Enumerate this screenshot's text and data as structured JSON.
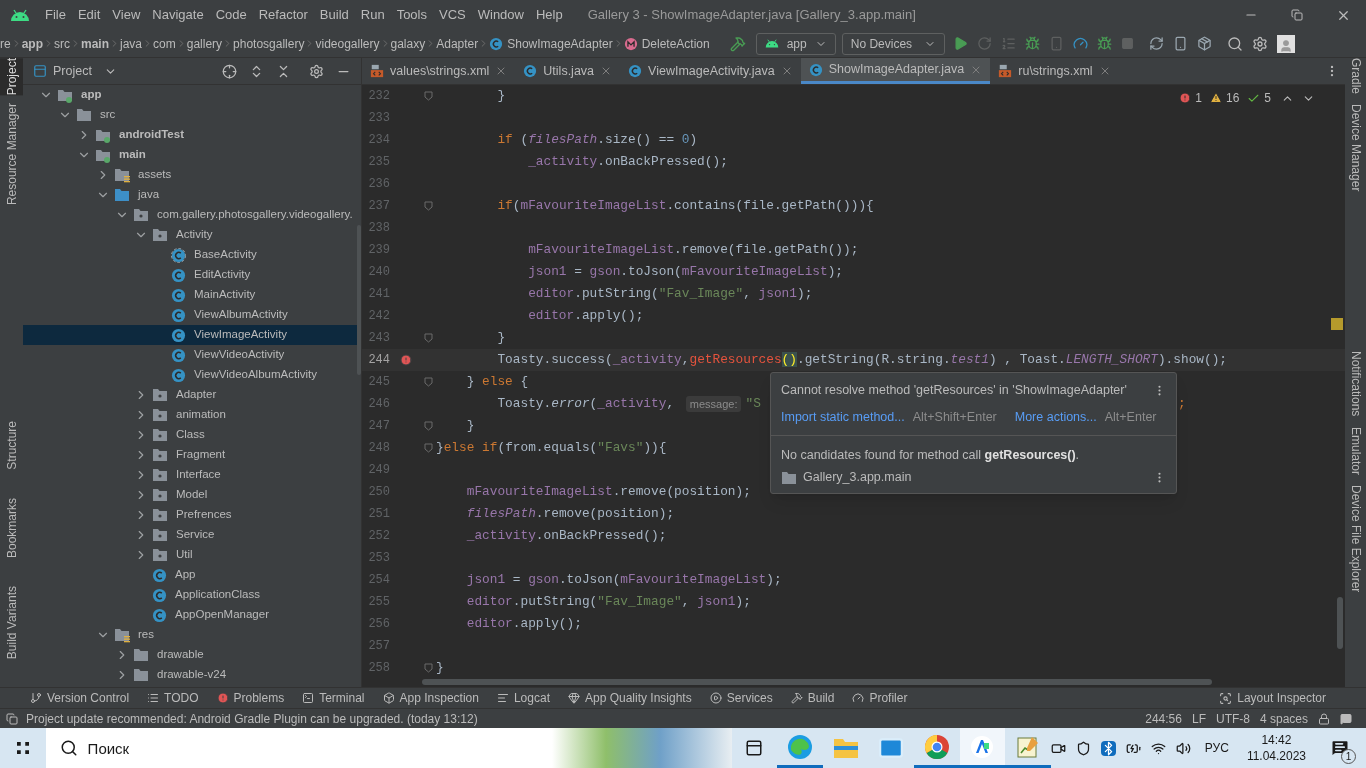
{
  "window": {
    "title": "Gallery 3 - ShowImageAdapter.java [Gallery_3.app.main]",
    "menu": [
      "File",
      "Edit",
      "View",
      "Navigate",
      "Code",
      "Refactor",
      "Build",
      "Run",
      "Tools",
      "VCS",
      "Window",
      "Help"
    ]
  },
  "navbar": {
    "breadcrumbs": [
      {
        "label": "re",
        "kind": "text"
      },
      {
        "label": "app",
        "kind": "bold"
      },
      {
        "label": "src",
        "kind": "text"
      },
      {
        "label": "main",
        "kind": "bold"
      },
      {
        "label": "java",
        "kind": "text"
      },
      {
        "label": "com",
        "kind": "text"
      },
      {
        "label": "gallery",
        "kind": "text"
      },
      {
        "label": "photosgallery",
        "kind": "text"
      },
      {
        "label": "videogallery",
        "kind": "text"
      },
      {
        "label": "galaxy",
        "kind": "text"
      },
      {
        "label": "Adapter",
        "kind": "text"
      },
      {
        "label": "ShowImageAdapter",
        "kind": "class"
      },
      {
        "label": "DeleteAction",
        "kind": "method"
      }
    ],
    "run_config": "app",
    "device": "No Devices"
  },
  "left_strip": [
    {
      "label": "Project",
      "selected": true
    },
    {
      "label": "Resource Manager",
      "selected": false
    },
    {
      "label": "Structure",
      "selected": false
    },
    {
      "label": "Bookmarks",
      "selected": false
    },
    {
      "label": "Build Variants",
      "selected": false
    }
  ],
  "right_strip": [
    "Gradle",
    "Device Manager",
    "Notifications",
    "Emulator",
    "Device File Explorer"
  ],
  "project_panel": {
    "title": "Project",
    "tree": [
      {
        "label": "app",
        "kind": "module",
        "expanded": true,
        "selected": false,
        "children": [
          {
            "label": "src",
            "kind": "folder",
            "expanded": true,
            "selected": false,
            "children": [
              {
                "label": "androidTest",
                "kind": "module",
                "expanded": false,
                "selected": false
              },
              {
                "label": "main",
                "kind": "module",
                "expanded": true,
                "selected": false,
                "children": [
                  {
                    "label": "assets",
                    "kind": "res-folder",
                    "expanded": false,
                    "selected": false
                  },
                  {
                    "label": "java",
                    "kind": "source-folder",
                    "expanded": true,
                    "selected": false,
                    "children": [
                      {
                        "label": "com.gallery.photosgallery.videogallery.",
                        "kind": "package",
                        "expanded": true,
                        "selected": false,
                        "children": [
                          {
                            "label": "Activity",
                            "kind": "package",
                            "expanded": true,
                            "selected": false,
                            "children": [
                              {
                                "label": "BaseActivity",
                                "kind": "abstract-class",
                                "selected": false
                              },
                              {
                                "label": "EditActivity",
                                "kind": "class",
                                "selected": false
                              },
                              {
                                "label": "MainActivity",
                                "kind": "class",
                                "selected": false
                              },
                              {
                                "label": "ViewAlbumActivity",
                                "kind": "class",
                                "selected": false
                              },
                              {
                                "label": "ViewImageActivity",
                                "kind": "class",
                                "selected": true
                              },
                              {
                                "label": "ViewVideoActivity",
                                "kind": "class",
                                "selected": false
                              },
                              {
                                "label": "ViewVideoAlbumActivity",
                                "kind": "class",
                                "selected": false
                              }
                            ]
                          },
                          {
                            "label": "Adapter",
                            "kind": "package",
                            "expanded": false,
                            "selected": false
                          },
                          {
                            "label": "animation",
                            "kind": "package",
                            "expanded": false,
                            "selected": false
                          },
                          {
                            "label": "Class",
                            "kind": "package",
                            "expanded": false,
                            "selected": false
                          },
                          {
                            "label": "Fragment",
                            "kind": "package",
                            "expanded": false,
                            "selected": false
                          },
                          {
                            "label": "Interface",
                            "kind": "package",
                            "expanded": false,
                            "selected": false
                          },
                          {
                            "label": "Model",
                            "kind": "package",
                            "expanded": false,
                            "selected": false
                          },
                          {
                            "label": "Prefrences",
                            "kind": "package",
                            "expanded": false,
                            "selected": false
                          },
                          {
                            "label": "Service",
                            "kind": "package",
                            "expanded": false,
                            "selected": false
                          },
                          {
                            "label": "Util",
                            "kind": "package",
                            "expanded": false,
                            "selected": false
                          },
                          {
                            "label": "App",
                            "kind": "class",
                            "selected": false
                          },
                          {
                            "label": "ApplicationClass",
                            "kind": "class",
                            "selected": false
                          },
                          {
                            "label": "AppOpenManager",
                            "kind": "class",
                            "selected": false
                          }
                        ]
                      }
                    ]
                  },
                  {
                    "label": "res",
                    "kind": "res-folder",
                    "expanded": true,
                    "selected": false,
                    "children": [
                      {
                        "label": "drawable",
                        "kind": "folder",
                        "expanded": false,
                        "selected": false
                      },
                      {
                        "label": "drawable-v24",
                        "kind": "folder",
                        "expanded": false,
                        "selected": false
                      }
                    ]
                  }
                ]
              }
            ]
          }
        ]
      }
    ]
  },
  "editor": {
    "tabs": [
      {
        "label": "values\\strings.xml",
        "kind": "xml",
        "selected": false
      },
      {
        "label": "Utils.java",
        "kind": "class",
        "selected": false
      },
      {
        "label": "ViewImageActivity.java",
        "kind": "class",
        "selected": false
      },
      {
        "label": "ShowImageAdapter.java",
        "kind": "class",
        "selected": true
      },
      {
        "label": "ru\\strings.xml",
        "kind": "xml",
        "selected": false
      }
    ],
    "indicators": {
      "errors": "1",
      "warnings": "16",
      "weak_warnings": "5"
    },
    "lines": [
      {
        "number": "232",
        "current": false,
        "error": false,
        "fold": true,
        "tokens": [
          {
            "kind": "plain",
            "text": "        }"
          }
        ]
      },
      {
        "number": "233",
        "current": false,
        "error": false,
        "fold": false
      },
      {
        "number": "234",
        "current": false,
        "error": false,
        "fold": false,
        "tokens": [
          {
            "kind": "keyword",
            "text": "        if"
          },
          {
            "kind": "plain",
            "text": " ("
          },
          {
            "kind": "static_field",
            "text": "filesPath"
          },
          {
            "kind": "plain",
            "text": ".size() == "
          },
          {
            "kind": "number",
            "text": "0"
          },
          {
            "kind": "plain",
            "text": ")"
          }
        ]
      },
      {
        "number": "235",
        "current": false,
        "error": false,
        "fold": false,
        "tokens": [
          {
            "kind": "field",
            "text": "            _activity"
          },
          {
            "kind": "plain",
            "text": ".onBackPressed();"
          }
        ]
      },
      {
        "number": "236",
        "current": false,
        "error": false,
        "fold": false
      },
      {
        "number": "237",
        "current": false,
        "error": false,
        "fold": true,
        "tokens": [
          {
            "kind": "keyword",
            "text": "        if"
          },
          {
            "kind": "plain",
            "text": "("
          },
          {
            "kind": "field",
            "text": "mFavouriteImageList"
          },
          {
            "kind": "plain",
            "text": ".contains(file.getPath())){"
          }
        ]
      },
      {
        "number": "238",
        "current": false,
        "error": false,
        "fold": false
      },
      {
        "number": "239",
        "current": false,
        "error": false,
        "fold": false,
        "tokens": [
          {
            "kind": "field",
            "text": "            mFavouriteImageList"
          },
          {
            "kind": "plain",
            "text": ".remove(file.getPath());"
          }
        ]
      },
      {
        "number": "240",
        "current": false,
        "error": false,
        "fold": false,
        "tokens": [
          {
            "kind": "field",
            "text": "            json1"
          },
          {
            "kind": "plain",
            "text": " = "
          },
          {
            "kind": "field",
            "text": "gson"
          },
          {
            "kind": "plain",
            "text": ".toJson("
          },
          {
            "kind": "field",
            "text": "mFavouriteImageList"
          },
          {
            "kind": "plain",
            "text": ");"
          }
        ]
      },
      {
        "number": "241",
        "current": false,
        "error": false,
        "fold": false,
        "tokens": [
          {
            "kind": "field",
            "text": "            editor"
          },
          {
            "kind": "plain",
            "text": ".putString("
          },
          {
            "kind": "string",
            "text": "\"Fav_Image\""
          },
          {
            "kind": "plain",
            "text": ", "
          },
          {
            "kind": "field",
            "text": "json1"
          },
          {
            "kind": "plain",
            "text": ");"
          }
        ]
      },
      {
        "number": "242",
        "current": false,
        "error": false,
        "fold": false,
        "tokens": [
          {
            "kind": "field",
            "text": "            editor"
          },
          {
            "kind": "plain",
            "text": ".apply();"
          }
        ]
      },
      {
        "number": "243",
        "current": false,
        "error": false,
        "fold": true,
        "tokens": [
          {
            "kind": "plain",
            "text": "        }"
          }
        ]
      },
      {
        "number": "244",
        "current": true,
        "error": true,
        "fold": false,
        "tokens": [
          {
            "kind": "plain",
            "text": "        Toasty.success("
          },
          {
            "kind": "field",
            "text": "_activity"
          },
          {
            "kind": "plain",
            "text": ","
          },
          {
            "kind": "error",
            "text": "getResources"
          },
          {
            "kind": "matched_brace",
            "text": "()"
          },
          {
            "kind": "plain",
            "text": ".getString(R.string."
          },
          {
            "kind": "static_field",
            "text": "test1"
          },
          {
            "kind": "plain",
            "text": ") , Toast."
          },
          {
            "kind": "static_field",
            "text": "LENGTH_SHORT"
          },
          {
            "kind": "plain",
            "text": ").show();"
          }
        ]
      },
      {
        "number": "245",
        "current": false,
        "error": false,
        "fold": true,
        "tokens": [
          {
            "kind": "plain",
            "text": "    } "
          },
          {
            "kind": "keyword",
            "text": "else"
          },
          {
            "kind": "plain",
            "text": " {"
          }
        ]
      },
      {
        "number": "246",
        "current": false,
        "error": false,
        "fold": false,
        "tokens": [
          {
            "kind": "plain",
            "text": "        Toasty."
          },
          {
            "kind": "static_method",
            "text": "error"
          },
          {
            "kind": "plain",
            "text": "("
          },
          {
            "kind": "field",
            "text": "_activity"
          },
          {
            "kind": "plain",
            "text": ", "
          },
          {
            "kind": "hint",
            "text": "message:"
          },
          {
            "kind": "string",
            "text": "\"S"
          }
        ],
        "tail": ";"
      },
      {
        "number": "247",
        "current": false,
        "error": false,
        "fold": true,
        "tokens": [
          {
            "kind": "plain",
            "text": "    }"
          }
        ]
      },
      {
        "number": "248",
        "current": false,
        "error": false,
        "fold": true,
        "tokens": [
          {
            "kind": "plain",
            "text": "}"
          },
          {
            "kind": "keyword",
            "text": "else if"
          },
          {
            "kind": "plain",
            "text": "(from.equals("
          },
          {
            "kind": "string",
            "text": "\"Favs\""
          },
          {
            "kind": "plain",
            "text": ")){"
          }
        ]
      },
      {
        "number": "249",
        "current": false,
        "error": false,
        "fold": false
      },
      {
        "number": "250",
        "current": false,
        "error": false,
        "fold": false,
        "tokens": [
          {
            "kind": "field",
            "text": "    mFavouriteImageList"
          },
          {
            "kind": "plain",
            "text": ".remove(position);"
          }
        ]
      },
      {
        "number": "251",
        "current": false,
        "error": false,
        "fold": false,
        "tokens": [
          {
            "kind": "static_field",
            "text": "    filesPath"
          },
          {
            "kind": "plain",
            "text": ".remove(position);"
          }
        ]
      },
      {
        "number": "252",
        "current": false,
        "error": false,
        "fold": false,
        "tokens": [
          {
            "kind": "field",
            "text": "    _activity"
          },
          {
            "kind": "plain",
            "text": ".onBackPressed();"
          }
        ]
      },
      {
        "number": "253",
        "current": false,
        "error": false,
        "fold": false
      },
      {
        "number": "254",
        "current": false,
        "error": false,
        "fold": false,
        "tokens": [
          {
            "kind": "field",
            "text": "    json1"
          },
          {
            "kind": "plain",
            "text": " = "
          },
          {
            "kind": "field",
            "text": "gson"
          },
          {
            "kind": "plain",
            "text": ".toJson("
          },
          {
            "kind": "field",
            "text": "mFavouriteImageList"
          },
          {
            "kind": "plain",
            "text": ");"
          }
        ]
      },
      {
        "number": "255",
        "current": false,
        "error": false,
        "fold": false,
        "tokens": [
          {
            "kind": "field",
            "text": "    editor"
          },
          {
            "kind": "plain",
            "text": ".putString("
          },
          {
            "kind": "string",
            "text": "\"Fav_Image\""
          },
          {
            "kind": "plain",
            "text": ", "
          },
          {
            "kind": "field",
            "text": "json1"
          },
          {
            "kind": "plain",
            "text": ");"
          }
        ]
      },
      {
        "number": "256",
        "current": false,
        "error": false,
        "fold": false,
        "tokens": [
          {
            "kind": "field",
            "text": "    editor"
          },
          {
            "kind": "plain",
            "text": ".apply();"
          }
        ]
      },
      {
        "number": "257",
        "current": false,
        "error": false,
        "fold": false
      },
      {
        "number": "258",
        "current": false,
        "error": false,
        "fold": true,
        "tokens": [
          {
            "kind": "plain",
            "text": "}"
          }
        ]
      }
    ],
    "popup": {
      "message": "Cannot resolve method 'getResources' in 'ShowImageAdapter'",
      "actions": [
        {
          "label": "Import static method...",
          "shortcut": "Alt+Shift+Enter"
        },
        {
          "label": "More actions...",
          "shortcut": "Alt+Enter"
        }
      ],
      "detail": "No candidates found for method call **getResources()**.",
      "module": "Gallery_3.app.main"
    }
  },
  "tool_bar": [
    {
      "label": "Version Control",
      "kind": "vcs"
    },
    {
      "label": "TODO",
      "kind": "todo"
    },
    {
      "label": "Problems",
      "kind": "problems"
    },
    {
      "label": "Terminal",
      "kind": "terminal"
    },
    {
      "label": "App Inspection",
      "kind": "inspection"
    },
    {
      "label": "Logcat",
      "kind": "logcat"
    },
    {
      "label": "App Quality Insights",
      "kind": "quality"
    },
    {
      "label": "Services",
      "kind": "services"
    },
    {
      "label": "Build",
      "kind": "build"
    },
    {
      "label": "Profiler",
      "kind": "profiler"
    }
  ],
  "tool_bar_right": "Layout Inspector",
  "status_bar": {
    "message": "Project update recommended: Android Gradle Plugin can be upgraded. (today 13:12)",
    "position": "244:56",
    "line_separator": "LF",
    "encoding": "UTF-8",
    "indent": "4 spaces"
  },
  "taskbar": {
    "search_placeholder": "Поиск",
    "apps": [
      {
        "kind": "edge",
        "running": true,
        "selected": false
      },
      {
        "kind": "explorer",
        "running": false,
        "selected": false
      },
      {
        "kind": "mail",
        "running": false,
        "selected": false
      },
      {
        "kind": "chrome",
        "running": true,
        "selected": false
      },
      {
        "kind": "android-studio",
        "running": true,
        "selected": true
      },
      {
        "kind": "notepad",
        "running": true,
        "selected": false
      }
    ],
    "language": "РУС",
    "time": "14:42",
    "date": "11.04.2023",
    "notifications": "1"
  }
}
